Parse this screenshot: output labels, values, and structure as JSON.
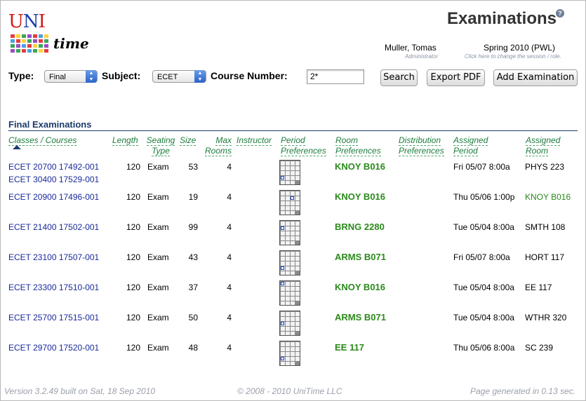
{
  "header": {
    "title": "Examinations",
    "help_icon": "question-mark",
    "logo_uni": "UNI",
    "logo_time": "time",
    "user_name": "Muller, Tomas",
    "user_role": "Administrator",
    "session": "Spring 2010 (PWL)",
    "session_hint": "Click here to change the session / role."
  },
  "filter": {
    "type_label": "Type:",
    "type_value": "Final",
    "subject_label": "Subject:",
    "subject_value": "ECET",
    "course_label": "Course Number:",
    "course_value": "2*",
    "search_button": "Search",
    "export_button": "Export PDF",
    "add_button": "Add Examination"
  },
  "section_title": "Final Examinations",
  "columns": {
    "classes": "Classes / Courses",
    "length": "Length",
    "seating_1": "Seating",
    "seating_2": "Type",
    "size": "Size",
    "max_1": "Max",
    "max_2": "Rooms",
    "instructor": "Instructor",
    "period_1": "Period",
    "period_2": "Preferences",
    "room_1": "Room",
    "room_2": "Preferences",
    "dist_1": "Distribution",
    "dist_2": "Preferences",
    "ap_1": "Assigned",
    "ap_2": "Period",
    "ar_1": "Assigned",
    "ar_2": "Room"
  },
  "rows": [
    {
      "classes": [
        "ECET 20700 17492-001",
        "ECET 30400 17529-001"
      ],
      "length": "120",
      "seating": "Exam",
      "size": "53",
      "max_rooms": "4",
      "room_pref": "KNOY B016",
      "assigned_period": "Fri 05/07 8:00a",
      "assigned_room": "PHYS 223",
      "room_green": false
    },
    {
      "classes": [
        "ECET 20900 17496-001"
      ],
      "length": "120",
      "seating": "Exam",
      "size": "19",
      "max_rooms": "4",
      "room_pref": "KNOY B016",
      "assigned_period": "Thu 05/06 1:00p",
      "assigned_room": "KNOY B016",
      "room_green": true
    },
    {
      "classes": [
        "ECET 21400 17502-001"
      ],
      "length": "120",
      "seating": "Exam",
      "size": "99",
      "max_rooms": "4",
      "room_pref": "BRNG 2280",
      "assigned_period": "Tue 05/04 8:00a",
      "assigned_room": "SMTH 108",
      "room_green": false
    },
    {
      "classes": [
        "ECET 23100 17507-001"
      ],
      "length": "120",
      "seating": "Exam",
      "size": "43",
      "max_rooms": "4",
      "room_pref": "ARMS B071",
      "assigned_period": "Fri 05/07 8:00a",
      "assigned_room": "HORT 117",
      "room_green": false
    },
    {
      "classes": [
        "ECET 23300 17510-001"
      ],
      "length": "120",
      "seating": "Exam",
      "size": "37",
      "max_rooms": "4",
      "room_pref": "KNOY B016",
      "assigned_period": "Tue 05/04 8:00a",
      "assigned_room": "EE 117",
      "room_green": false
    },
    {
      "classes": [
        "ECET 25700 17515-001"
      ],
      "length": "120",
      "seating": "Exam",
      "size": "50",
      "max_rooms": "4",
      "room_pref": "ARMS B071",
      "assigned_period": "Tue 05/04 8:00a",
      "assigned_room": "WTHR 320",
      "room_green": false
    },
    {
      "classes": [
        "ECET 29700 17520-001"
      ],
      "length": "120",
      "seating": "Exam",
      "size": "48",
      "max_rooms": "4",
      "room_pref": "EE 117",
      "assigned_period": "Thu 05/06 8:00a",
      "assigned_room": "SC 239",
      "room_green": false
    }
  ],
  "footer": {
    "version": "Version 3.2.49 built on Sat, 18 Sep 2010",
    "copyright": "© 2008 - 2010 UniTime LLC",
    "generated": "Page generated in 0.13 sec."
  }
}
